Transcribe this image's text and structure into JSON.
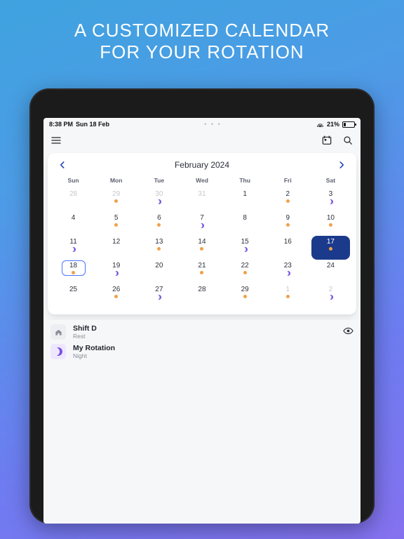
{
  "marketing": {
    "line1": "A CUSTOMIZED CALENDAR",
    "line2": "FOR YOUR ROTATION"
  },
  "status": {
    "time": "8:38 PM",
    "date": "Sun 18 Feb",
    "center": "• • •",
    "battery_pct": "21%"
  },
  "calendar": {
    "title": "February 2024",
    "dow": [
      "Sun",
      "Mon",
      "Tue",
      "Wed",
      "Thu",
      "Fri",
      "Sat"
    ],
    "weeks": [
      [
        {
          "n": "28",
          "out": true
        },
        {
          "n": "29",
          "out": true,
          "dot": true
        },
        {
          "n": "30",
          "out": true,
          "moon": true
        },
        {
          "n": "31",
          "out": true
        },
        {
          "n": "1"
        },
        {
          "n": "2",
          "dot": true
        },
        {
          "n": "3",
          "moon": true
        }
      ],
      [
        {
          "n": "4"
        },
        {
          "n": "5",
          "dot": true
        },
        {
          "n": "6",
          "dot": true
        },
        {
          "n": "7",
          "moon": true
        },
        {
          "n": "8"
        },
        {
          "n": "9",
          "dot": true
        },
        {
          "n": "10",
          "dot": true
        }
      ],
      [
        {
          "n": "11",
          "moon": true
        },
        {
          "n": "12"
        },
        {
          "n": "13",
          "dot": true
        },
        {
          "n": "14",
          "dot": true
        },
        {
          "n": "15",
          "moon": true
        },
        {
          "n": "16"
        },
        {
          "n": "17",
          "dot": true,
          "selected": true
        }
      ],
      [
        {
          "n": "18",
          "dot": true,
          "today": true
        },
        {
          "n": "19",
          "moon": true
        },
        {
          "n": "20"
        },
        {
          "n": "21",
          "dot": true
        },
        {
          "n": "22",
          "dot": true
        },
        {
          "n": "23",
          "moon": true
        },
        {
          "n": "24"
        }
      ],
      [
        {
          "n": "25"
        },
        {
          "n": "26",
          "dot": true
        },
        {
          "n": "27",
          "moon": true
        },
        {
          "n": "28"
        },
        {
          "n": "29",
          "dot": true
        },
        {
          "n": "1",
          "out": true,
          "dot": true
        },
        {
          "n": "2",
          "out": true,
          "moon": true
        }
      ]
    ]
  },
  "events": [
    {
      "icon": "home",
      "title": "Shift D",
      "sub": "Rest",
      "eye": true
    },
    {
      "icon": "moon",
      "title": "My Rotation",
      "sub": "Night",
      "eye": false
    }
  ]
}
